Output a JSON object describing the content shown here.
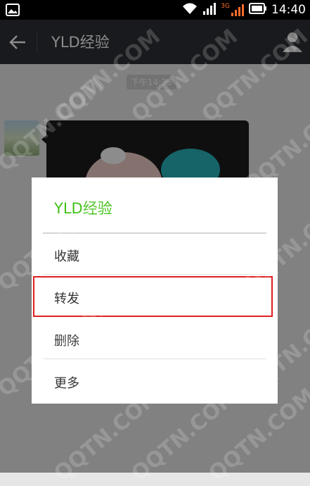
{
  "status_bar": {
    "network_label": "3G",
    "time": "14:40"
  },
  "header": {
    "title": "YLD经验"
  },
  "chat": {
    "timestamp": "下午14:38"
  },
  "dialog": {
    "title": "YLD经验",
    "items": [
      {
        "label": "收藏"
      },
      {
        "label": "转发"
      },
      {
        "label": "删除"
      },
      {
        "label": "更多"
      }
    ]
  },
  "watermark_text": "QQTN.COM",
  "colors": {
    "accent": "#45c01a",
    "highlight": "#e02020",
    "header_bg": "#2f3136"
  }
}
